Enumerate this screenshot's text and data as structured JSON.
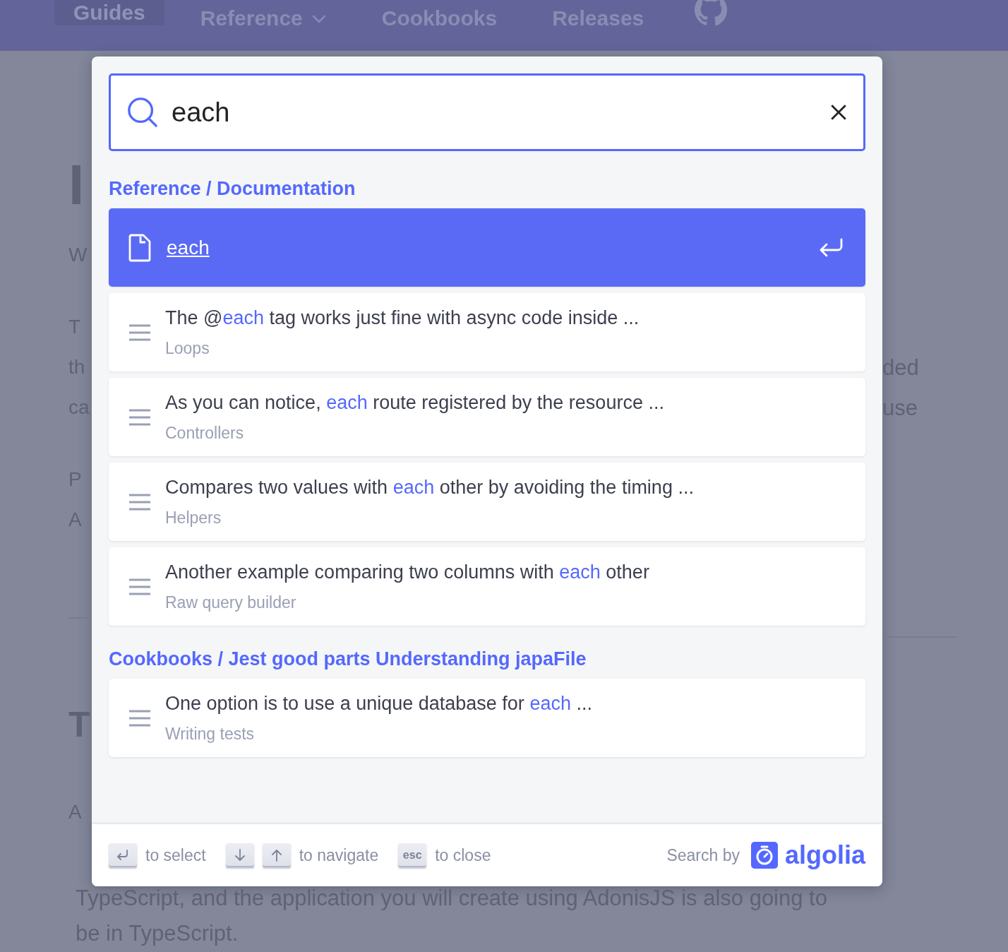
{
  "nav": {
    "items": [
      {
        "label": "Guides",
        "kind": "link",
        "selected": true
      },
      {
        "label": "Reference",
        "kind": "dropdown",
        "selected": false
      },
      {
        "label": "Cookbooks",
        "kind": "link",
        "selected": false
      },
      {
        "label": "Releases",
        "kind": "link",
        "selected": false
      },
      {
        "kind": "github",
        "selected": false
      }
    ]
  },
  "page": {
    "left_fragments": [
      {
        "text": "I",
        "kind": "heading"
      },
      {
        "text": "W",
        "kind": "line"
      },
      {
        "text": "T",
        "kind": "line"
      },
      {
        "text": "th",
        "kind": "line"
      },
      {
        "text": "ca",
        "kind": "line"
      },
      {
        "text": "P",
        "kind": "line"
      },
      {
        "text": "A",
        "kind": "line"
      },
      {
        "kind": "divider"
      },
      {
        "text": "T",
        "kind": "heading"
      },
      {
        "text": "A",
        "kind": "line"
      }
    ],
    "right_fragments": [
      {
        "text": "ded",
        "kind": "line"
      },
      {
        "text": "use",
        "kind": "line"
      },
      {
        "kind": "divider"
      }
    ],
    "bottom_lines": [
      "TypeScript, and the application you will create using AdonisJS is also going to",
      "be in TypeScript."
    ]
  },
  "search": {
    "query": "each"
  },
  "groups": [
    {
      "title": "Reference / Documentation",
      "hits": [
        {
          "kind": "page",
          "title": "each",
          "selected": true
        },
        {
          "kind": "content",
          "parts": [
            {
              "text": "The @",
              "match": false
            },
            {
              "text": "each",
              "match": true
            },
            {
              "text": " tag works just fine with async code inside ...",
              "match": false
            }
          ],
          "path": "Loops",
          "selected": false
        },
        {
          "kind": "content",
          "parts": [
            {
              "text": "As you can notice, ",
              "match": false
            },
            {
              "text": "each",
              "match": true
            },
            {
              "text": " route registered by the resource ...",
              "match": false
            }
          ],
          "path": "Controllers",
          "selected": false
        },
        {
          "kind": "content",
          "parts": [
            {
              "text": "Compares two values with ",
              "match": false
            },
            {
              "text": "each",
              "match": true
            },
            {
              "text": " other by avoiding the timing ...",
              "match": false
            }
          ],
          "path": "Helpers",
          "selected": false
        },
        {
          "kind": "content",
          "parts": [
            {
              "text": "Another example comparing two columns with ",
              "match": false
            },
            {
              "text": "each",
              "match": true
            },
            {
              "text": " other",
              "match": false
            }
          ],
          "path": "Raw query builder",
          "selected": false
        }
      ]
    },
    {
      "title": "Cookbooks / Jest good parts Understanding japaFile",
      "hits": [
        {
          "kind": "content",
          "parts": [
            {
              "text": "One option is to use a unique database for ",
              "match": false
            },
            {
              "text": "each",
              "match": true
            },
            {
              "text": " ...",
              "match": false
            }
          ],
          "path": "Writing tests",
          "selected": false
        }
      ]
    }
  ],
  "footer": {
    "hints": [
      {
        "keys": [
          {
            "kind": "enter"
          }
        ],
        "label": "to select"
      },
      {
        "keys": [
          {
            "kind": "down"
          },
          {
            "kind": "up"
          }
        ],
        "label": "to navigate"
      },
      {
        "keys": [
          {
            "kind": "text",
            "text": "esc"
          }
        ],
        "label": "to close"
      }
    ],
    "search_by": "Search by",
    "brand": "algolia"
  }
}
